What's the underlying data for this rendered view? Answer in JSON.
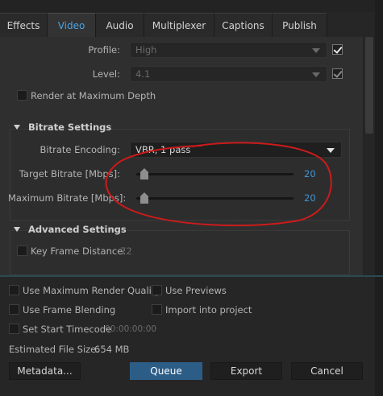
{
  "tabs": [
    "Effects",
    "Video",
    "Audio",
    "Multiplexer",
    "Captions",
    "Publish"
  ],
  "active_tab": "Video",
  "video": {
    "profile_label": "Profile:",
    "profile_value": "High",
    "level_label": "Level:",
    "level_value": "4.1",
    "render_max_depth": "Render at Maximum Depth"
  },
  "bitrate": {
    "title": "Bitrate Settings",
    "encoding_label": "Bitrate Encoding:",
    "encoding_value": "VBR, 1 pass",
    "target_label": "Target Bitrate [Mbps]:",
    "target_value": "20",
    "max_label": "Maximum Bitrate [Mbps]:",
    "max_value": "20"
  },
  "advanced": {
    "title": "Advanced Settings",
    "keyframe_label": "Key Frame Distance:",
    "keyframe_value": "72"
  },
  "options": {
    "max_render_quality": "Use Maximum Render Quality",
    "use_previews": "Use Previews",
    "frame_blending": "Use Frame Blending",
    "import_project": "Import into project",
    "start_timecode": "Set Start Timecode",
    "timecode_value": "00:00:00:00"
  },
  "file_size": {
    "label": "Estimated File Size:",
    "value": "654 MB"
  },
  "buttons": {
    "metadata": "Metadata...",
    "queue": "Queue",
    "export": "Export",
    "cancel": "Cancel"
  },
  "colors": {
    "accent": "#3f95d6",
    "annotation": "#cc1b1b"
  }
}
